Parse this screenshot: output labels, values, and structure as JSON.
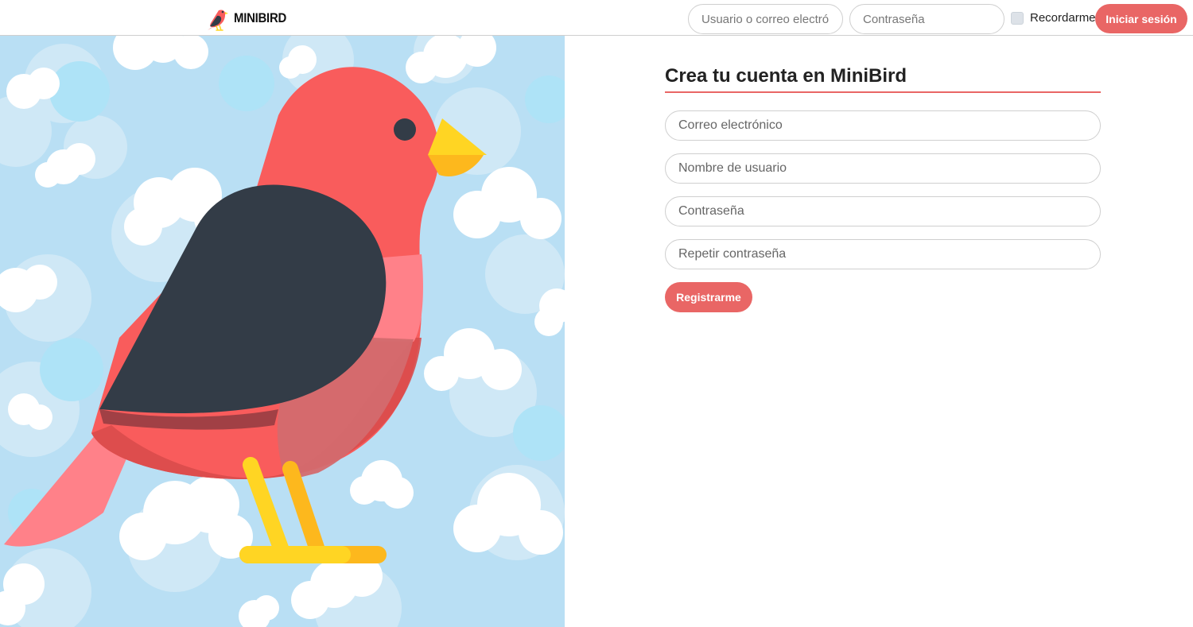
{
  "brand": {
    "name": "MINIBIRD",
    "logo_icon": "bird-icon"
  },
  "nav": {
    "user_placeholder": "Usuario o correo electrónico",
    "password_placeholder": "Contraseña",
    "remember_label": "Recordarme",
    "login_label": "Iniciar sesión"
  },
  "hero": {
    "illustration": "bird-illustration"
  },
  "signup": {
    "title": "Crea tu cuenta en MiniBird",
    "email_placeholder": "Correo electrónico",
    "username_placeholder": "Nombre de usuario",
    "password_placeholder": "Contraseña",
    "repeat_password_placeholder": "Repetir contraseña",
    "submit_label": "Registrarme"
  },
  "colors": {
    "accent": "#e96665",
    "bird_red": "#f95c5c",
    "bird_wing": "#333c47",
    "beak": "#ffd523",
    "sky": "#b9dff4"
  }
}
